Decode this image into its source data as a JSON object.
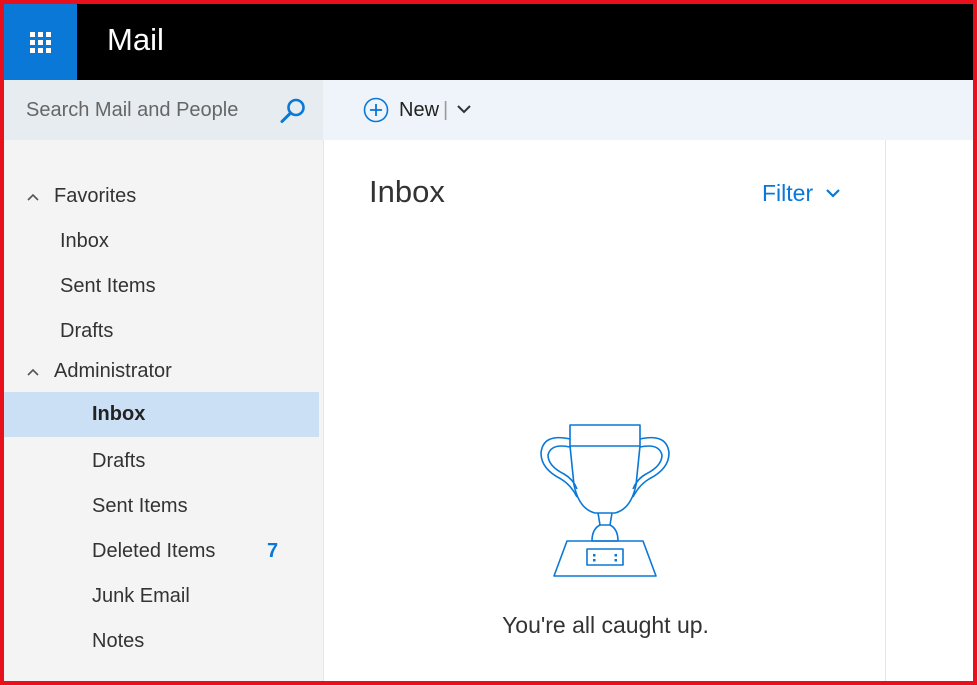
{
  "header": {
    "app_title": "Mail",
    "launcher_icon": "app-launcher-waffle-icon",
    "background_color": "#000000",
    "launcher_color": "#0a78d7"
  },
  "search": {
    "placeholder": "Search Mail and People",
    "value": "",
    "icon": "search-icon"
  },
  "toolbar": {
    "new_label": "New",
    "separator": "|",
    "new_icon": "plus-circle-icon",
    "dropdown_icon": "chevron-down-icon"
  },
  "sidebar": {
    "favorites": {
      "label": "Favorites",
      "items": [
        {
          "label": "Inbox"
        },
        {
          "label": "Sent Items"
        },
        {
          "label": "Drafts"
        }
      ]
    },
    "account": {
      "label": "Administrator",
      "items": [
        {
          "label": "Inbox",
          "selected": true
        },
        {
          "label": "Drafts"
        },
        {
          "label": "Sent Items"
        },
        {
          "label": "Deleted Items",
          "count": "7"
        },
        {
          "label": "Junk Email"
        },
        {
          "label": "Notes"
        }
      ]
    },
    "selected_color": "#cce0f5",
    "badge_color": "#0a78d7"
  },
  "main": {
    "title": "Inbox",
    "filter_label": "Filter",
    "empty_message": "You're all caught up.",
    "empty_icon": "trophy-icon",
    "accent_color": "#0a78d7"
  }
}
